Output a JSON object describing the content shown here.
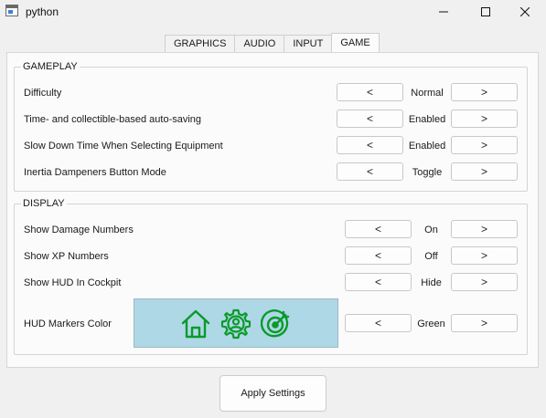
{
  "window": {
    "title": "python",
    "icon": "app-window-icon",
    "controls": [
      "minimize-icon",
      "maximize-icon",
      "close-icon"
    ]
  },
  "tabs": [
    {
      "label": "GRAPHICS",
      "active": false
    },
    {
      "label": "AUDIO",
      "active": false
    },
    {
      "label": "INPUT",
      "active": false
    },
    {
      "label": "GAME",
      "active": true
    }
  ],
  "gameplay": {
    "title": "GAMEPLAY",
    "rows": [
      {
        "label": "Difficulty",
        "prev": "<",
        "value": "Normal",
        "next": ">"
      },
      {
        "label": "Time- and collectible-based auto-saving",
        "prev": "<",
        "value": "Enabled",
        "next": ">"
      },
      {
        "label": "Slow Down Time When Selecting Equipment",
        "prev": "<",
        "value": "Enabled",
        "next": ">"
      },
      {
        "label": "Inertia Dampeners Button Mode",
        "prev": "<",
        "value": "Toggle",
        "next": ">"
      }
    ]
  },
  "display": {
    "title": "DISPLAY",
    "rows": [
      {
        "label": "Show Damage Numbers",
        "prev": "<",
        "value": "On",
        "next": ">"
      },
      {
        "label": "Show XP Numbers",
        "prev": "<",
        "value": "Off",
        "next": ">"
      },
      {
        "label": "Show HUD In Cockpit",
        "prev": "<",
        "value": "Hide",
        "next": ">"
      },
      {
        "label": "HUD Markers Color",
        "prev": "<",
        "value": "Green",
        "next": ">"
      }
    ],
    "preview": {
      "background": "#aed8e6",
      "marker_color": "#0a9a2a",
      "icons": [
        "home-marker-icon",
        "gear-person-marker-icon",
        "target-marker-icon"
      ]
    }
  },
  "apply_label": "Apply Settings"
}
